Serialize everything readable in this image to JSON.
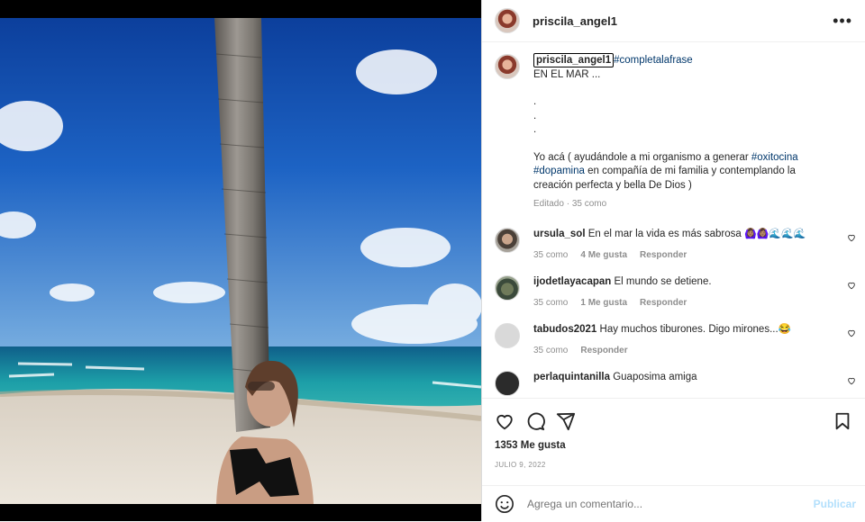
{
  "post": {
    "username": "priscila_angel1",
    "caption": {
      "tag_first": "#completalafrase",
      "line1": "EN EL MAR ...",
      "dots": ".",
      "text_a": "Yo acá ( ayudándole a mi organismo a generar ",
      "tag_oxitocina": "#oxitocina",
      "tag_dopamina": "#dopamina",
      "text_b": " en compañía de mi familia y contemplando la creación perfecta y bella De Dios )",
      "edited": "Editado",
      "likes": "35 como"
    },
    "comments": [
      {
        "user": "ursula_sol",
        "text": "En el mar la vida es más sabrosa ",
        "emoji": "🙆🏽‍♀️🙆🏽‍♀️🌊🌊🌊",
        "likes": "35 como",
        "like_count": "4 Me gusta",
        "reply": "Responder"
      },
      {
        "user": "ijodetlayacapan",
        "text": "El mundo se detiene.",
        "likes": "35 como",
        "like_count": "1 Me gusta",
        "reply": "Responder"
      },
      {
        "user": "tabudos2021",
        "text": "Hay muchos tiburones. Digo mirones...",
        "emoji": "😂",
        "likes": "35 como",
        "reply": "Responder"
      },
      {
        "user": "perlaquintanilla",
        "text": "Guaposima amiga"
      }
    ],
    "like_total": "1353 Me gusta",
    "date": "JULIO 9, 2022",
    "comment_placeholder": "Agrega un comentario...",
    "publish_label": "Publicar"
  }
}
